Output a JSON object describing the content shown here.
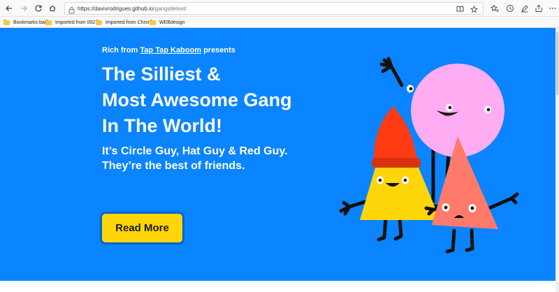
{
  "browser": {
    "url_host": "https://davivrodrigues.github.io",
    "url_path": "/gangsitetest/",
    "bookmarks": [
      "Bookmarks bar",
      "Imported from 002",
      "Imported from Chron",
      "WEBdesign"
    ]
  },
  "hero": {
    "presents_prefix": "Rich from",
    "presents_link": "Tap Tap Kaboom",
    "presents_suffix": "presents",
    "headline_line1": "The Silliest &",
    "headline_line2": "Most Awesome Gang",
    "headline_line3": "In The World!",
    "subhead_line1": "It’s Circle Guy, Hat Guy & Red Guy.",
    "subhead_line2": "They’re the best of friends.",
    "read_more": "Read More"
  },
  "colors": {
    "hero_bg": "#0a84ff",
    "button_bg": "#ffd60a",
    "circle_guy": "#ffadf3",
    "hat_guy_body": "#ffd60a",
    "hat_guy_hat": "#ff3b14",
    "red_guy": "#ff7a6b"
  }
}
